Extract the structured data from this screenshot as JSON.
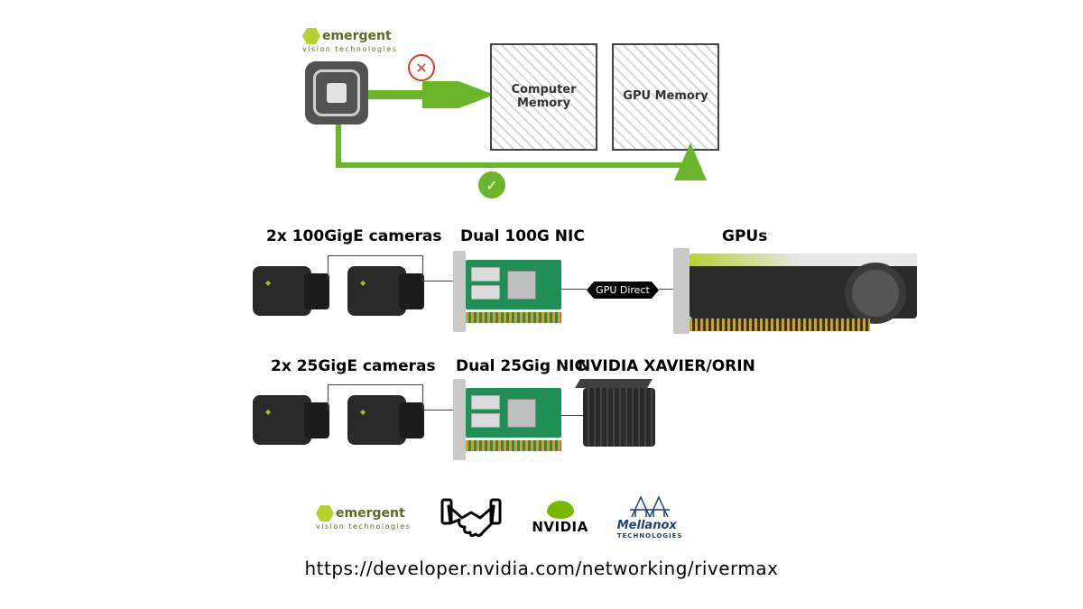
{
  "top": {
    "brand": "emergent",
    "brand_sub": "vision technologies",
    "box1": "Computer Memory",
    "box2": "GPU Memory",
    "fail_symbol": "✕",
    "ok_symbol": "✓"
  },
  "row1": {
    "cameras_label": "2x 100GigE cameras",
    "nic_label": "Dual 100G NIC",
    "gpudirect_label": "GPU Direct",
    "gpu_label": "GPUs"
  },
  "row2": {
    "cameras_label": "2x 25GigE cameras",
    "nic_label": "Dual 25Gig NIC",
    "soc_label": "NVIDIA XAVIER/ORIN"
  },
  "partners": {
    "emergent": "emergent",
    "emergent_sub": "vision technologies",
    "handshake_glyph": "🤝",
    "nvidia": "NVIDIA",
    "mellanox": "Mellanox",
    "mellanox_sub": "TECHNOLOGIES"
  },
  "url": "https://developer.nvidia.com/networking/rivermax"
}
